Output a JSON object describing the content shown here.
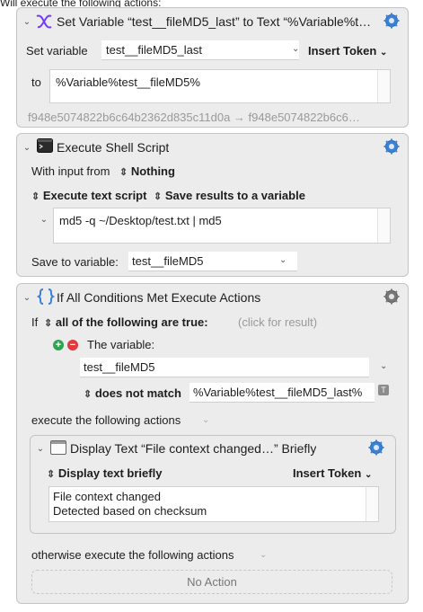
{
  "top_text": "Will execute the following actions:",
  "block1": {
    "title": "Set Variable “test__fileMD5_last” to Text “%Variable%tes…",
    "set_variable_label": "Set variable",
    "variable_name": "test__fileMD5_last",
    "insert_token": "Insert Token",
    "to_label": "to",
    "to_value": "%Variable%test__fileMD5%",
    "result_preview": "f948e5074822b6c64b2362d835c11d0a → f948e5074822b6c6…"
  },
  "block2": {
    "title": "Execute Shell Script",
    "with_input_label": "With input from",
    "with_input_value": "Nothing",
    "execute_mode": "Execute text script",
    "save_mode": "Save results to a variable",
    "script": "md5 -q ~/Desktop/test.txt | md5",
    "save_to_label": "Save to variable:",
    "save_to_value": "test__fileMD5"
  },
  "block3": {
    "title": "If All Conditions Met Execute Actions",
    "if_label": "If",
    "condition_scope": "all of the following are true:",
    "click_for_result": "(click for result)",
    "condition_label": "The variable:",
    "condition_variable": "test__fileMD5",
    "match_mode": "does not match",
    "match_value": "%Variable%test__fileMD5_last%",
    "token_t": "T",
    "execute_label": "execute the following actions",
    "otherwise_label": "otherwise execute the following actions",
    "no_action": "No Action",
    "inner": {
      "title": "Display Text “File context changed…” Briefly",
      "mode": "Display text briefly",
      "insert_token": "Insert Token",
      "text_line1": "File context changed",
      "text_line2": "Detected based on checksum"
    }
  },
  "colors": {
    "accent_purple": "#6f3ff5",
    "gear_blue": "#3b82d6",
    "plus_green": "#2ea44f",
    "minus_red": "#e0393e",
    "block_bg": "#ececec"
  }
}
